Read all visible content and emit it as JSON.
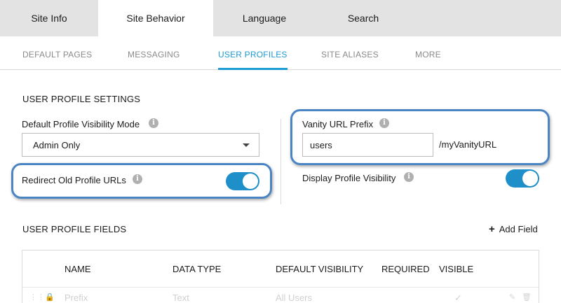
{
  "top_tabs": [
    {
      "label": "Site Info"
    },
    {
      "label": "Site Behavior"
    },
    {
      "label": "Language"
    },
    {
      "label": "Search"
    }
  ],
  "sub_tabs": [
    {
      "label": "DEFAULT PAGES"
    },
    {
      "label": "MESSAGING"
    },
    {
      "label": "USER PROFILES"
    },
    {
      "label": "SITE ALIASES"
    },
    {
      "label": "MORE"
    }
  ],
  "settings": {
    "section_title": "USER PROFILE SETTINGS",
    "visibility_mode_label": "Default Profile Visibility Mode",
    "visibility_mode_value": "Admin Only",
    "redirect_label": "Redirect Old Profile URLs",
    "redirect_enabled": true,
    "vanity_label": "Vanity URL Prefix",
    "vanity_value": "users",
    "vanity_suffix": "/myVanityURL",
    "display_visibility_label": "Display Profile Visibility",
    "display_visibility_enabled": true
  },
  "fields": {
    "section_title": "USER PROFILE FIELDS",
    "add_field_label": "Add Field",
    "columns": [
      "NAME",
      "DATA TYPE",
      "DEFAULT VISIBILITY",
      "REQUIRED",
      "VISIBLE"
    ],
    "rows": [
      {
        "name": "Prefix",
        "data_type": "Text",
        "default_visibility": "All Users",
        "required": "",
        "visible": "✓"
      }
    ]
  },
  "colors": {
    "accent": "#1e9bd1",
    "toggle_on": "#1e8fc9",
    "highlight_border": "#4b84c3",
    "tab_bar_bg": "#e3e3e3"
  },
  "icons": [
    "info-icon",
    "caret-down-icon",
    "plus-icon",
    "drag-handle-icon",
    "lock-icon",
    "check-icon",
    "edit-icon",
    "delete-icon"
  ]
}
